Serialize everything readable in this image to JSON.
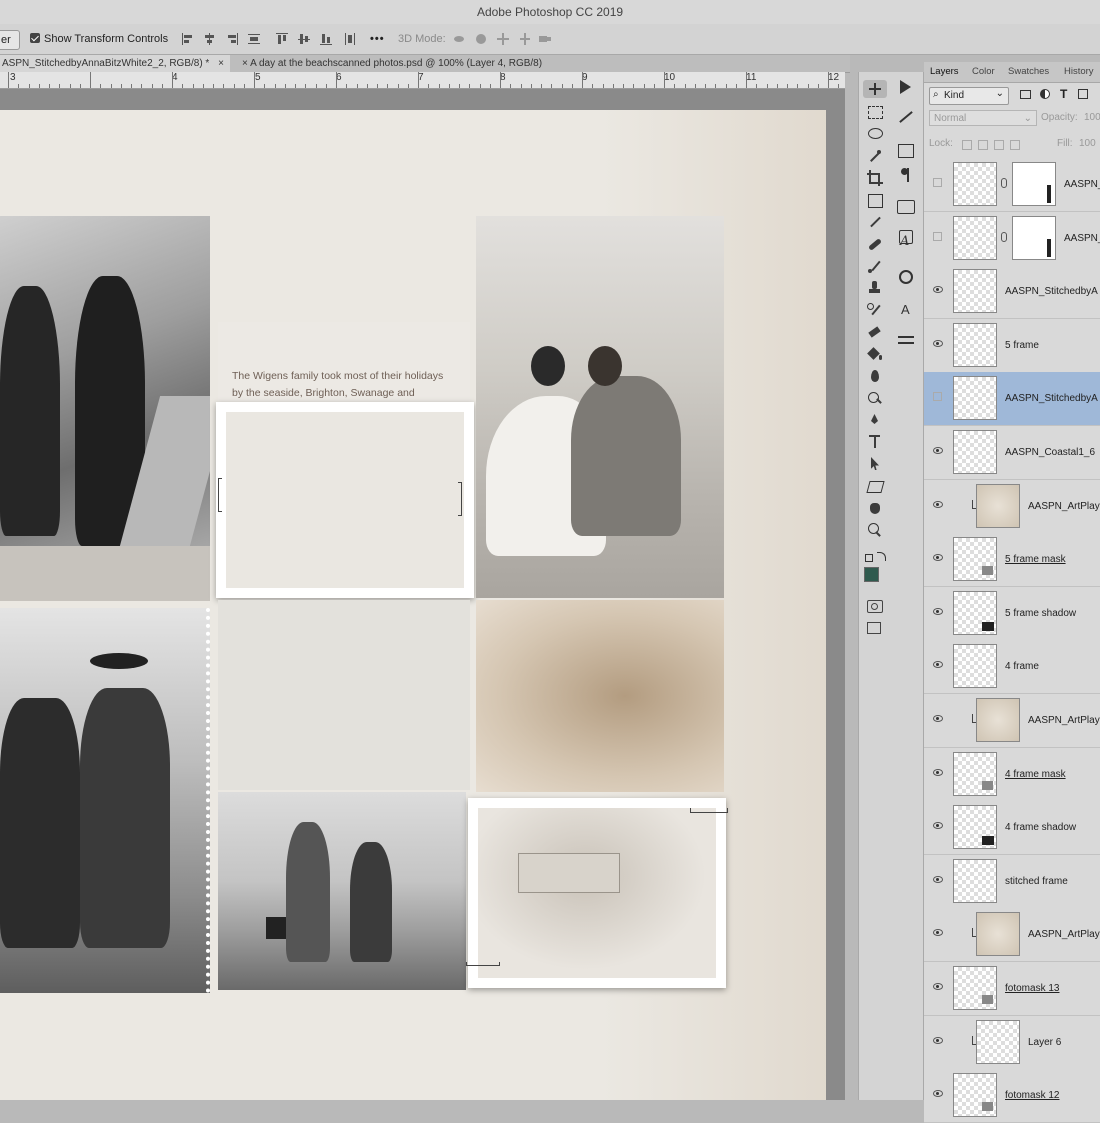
{
  "app": {
    "title": "Adobe Photoshop CC 2019"
  },
  "options_bar": {
    "layer_dropdown": "er",
    "show_transform_label": "Show Transform Controls",
    "more_label": "•••",
    "mode_3d_label": "3D Mode:"
  },
  "doc_tabs": [
    {
      "label": "ASPN_StitchedbyAnnaBitzWhite2_2, RGB/8) *",
      "close": "×"
    },
    {
      "label": "A day at the beachscanned photos.psd @ 100% (Layer 4, RGB/8)",
      "close": "×"
    }
  ],
  "ruler": {
    "labels": [
      "3",
      "4",
      "5",
      "6",
      "7",
      "8",
      "9",
      "10",
      "11",
      "12"
    ]
  },
  "canvas": {
    "journal_text": "The Wigens family took most of their holidays by the seaside, Brighton, Swanage and Trevean.I wonder how common it was for the children to be able to swim."
  },
  "tools": [
    "move-tool",
    "marquee-tool",
    "lasso-tool",
    "quick-select-tool",
    "crop-tool",
    "frame-tool",
    "eyedropper-tool",
    "healing-tool",
    "brush-tool",
    "clone-stamp-tool",
    "history-brush-tool",
    "eraser-tool",
    "paint-bucket-tool",
    "blur-tool",
    "dodge-tool",
    "pen-tool",
    "type-tool",
    "path-select-tool",
    "shape-tool",
    "hand-tool",
    "zoom-tool"
  ],
  "colors": {
    "foreground": "#2f5a4e",
    "background": "#ffffff",
    "selection": "#9fb8d8"
  },
  "panel": {
    "tabs": [
      "Layers",
      "Color",
      "Swatches",
      "History"
    ],
    "filter_kind": "Kind",
    "blend_mode": "Normal",
    "opacity_label": "Opacity:",
    "opacity_value": "100",
    "lock_label": "Lock:",
    "fill_label": "Fill:",
    "fill_value": "100",
    "layers": [
      {
        "name": "AASPN_",
        "visible": false,
        "mask": true
      },
      {
        "name": "AASPN_",
        "visible": false,
        "mask": true
      },
      {
        "name": "AASPN_StitchedbyA",
        "visible": true
      },
      {
        "name": "5 frame",
        "visible": true
      },
      {
        "name": "AASPN_StitchedbyA",
        "visible": false,
        "selected": true
      },
      {
        "name": "AASPN_Coastal1_6",
        "visible": true
      },
      {
        "name": "AASPN_ArtPlay",
        "visible": true,
        "clipped": true
      },
      {
        "name": "5 frame mask",
        "visible": true,
        "underline": true
      },
      {
        "name": "5 frame shadow",
        "visible": true
      },
      {
        "name": "4 frame",
        "visible": true
      },
      {
        "name": "AASPN_ArtPlay",
        "visible": true,
        "clipped": true
      },
      {
        "name": "4 frame mask",
        "visible": true,
        "underline": true
      },
      {
        "name": "4 frame shadow",
        "visible": true
      },
      {
        "name": "stitched frame",
        "visible": true
      },
      {
        "name": "AASPN_ArtPlay",
        "visible": true,
        "clipped": true
      },
      {
        "name": "fotomask 13",
        "visible": true,
        "underline": true
      },
      {
        "name": "Layer 6",
        "visible": true,
        "clipped": true
      },
      {
        "name": "fotomask 12",
        "visible": true,
        "underline": true
      }
    ]
  }
}
